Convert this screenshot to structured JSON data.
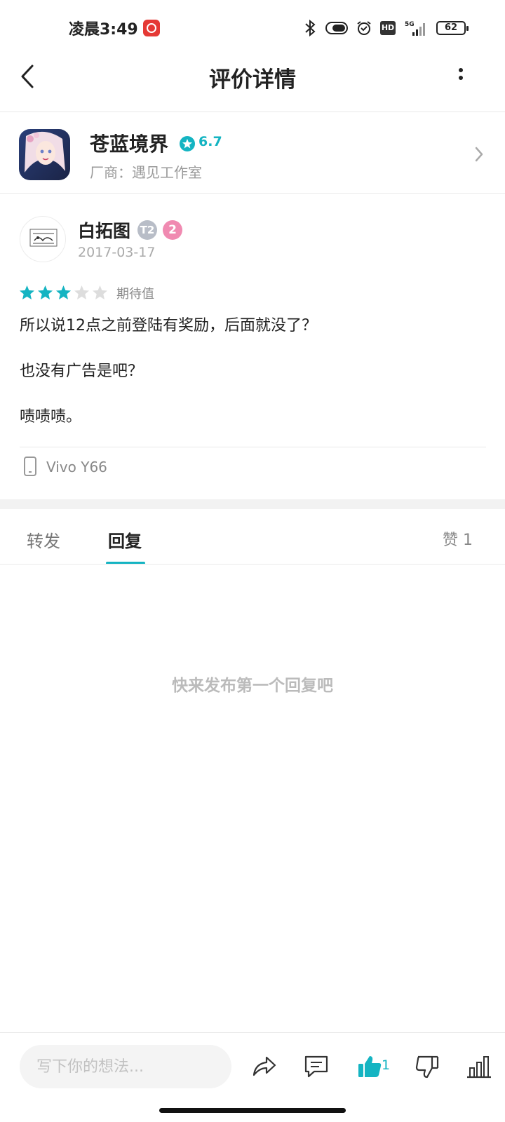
{
  "status_bar": {
    "time": "凌晨3:49",
    "network": "5G",
    "hd": "HD",
    "battery": "62"
  },
  "header": {
    "title": "评价详情"
  },
  "app": {
    "name": "苍蓝境界",
    "score": "6.7",
    "developer": "厂商：遇见工作室"
  },
  "review": {
    "user_name": "白拓图",
    "badge_t": "T2",
    "badge_level": "2",
    "date": "2017-03-17",
    "stars_filled": 3,
    "stars_total": 5,
    "rating_label": "期待值",
    "lines": [
      "所以说12点之前登陆有奖励，后面就没了？",
      "也没有广告是吧？",
      "啧啧啧。"
    ],
    "device": "Vivo Y66"
  },
  "tabs": {
    "forward": "转发",
    "reply": "回复",
    "likes": "赞 1"
  },
  "empty_hint": "快来发布第一个回复吧",
  "bottom_bar": {
    "input_placeholder": "写下你的想法...",
    "like_count": "1"
  },
  "colors": {
    "accent": "#14b4c2",
    "star_empty": "#dddddd"
  },
  "icons": [
    "back-icon",
    "more-icon",
    "chevron-right-icon",
    "star-icon",
    "phone-icon",
    "share-icon",
    "comment-icon",
    "thumbs-up-icon",
    "thumbs-down-icon",
    "stats-icon"
  ]
}
